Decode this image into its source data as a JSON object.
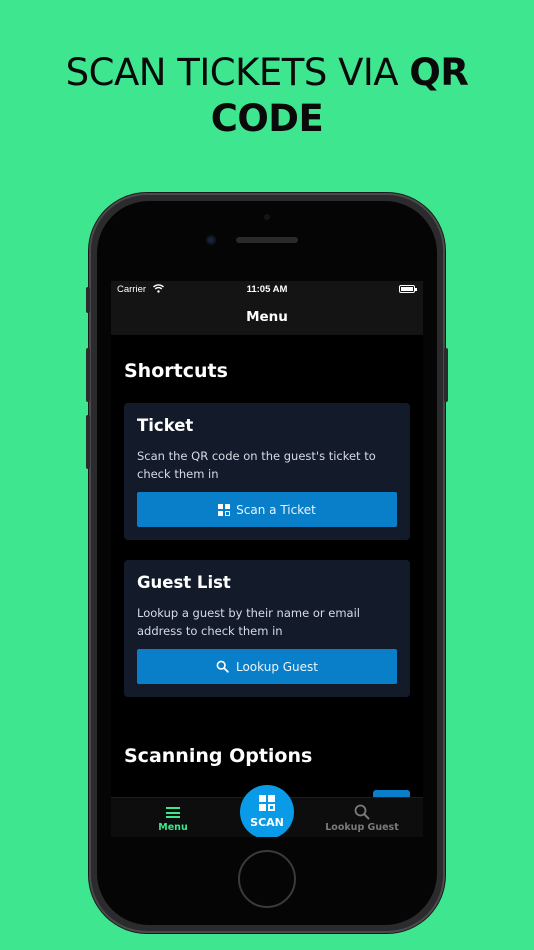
{
  "headline": {
    "light": "SCAN TICKETS VIA ",
    "bold_1": "QR",
    "bold_2": "CODE"
  },
  "status_bar": {
    "carrier": "Carrier",
    "time": "11:05 AM"
  },
  "nav": {
    "title": "Menu"
  },
  "shortcuts": {
    "title": "Shortcuts",
    "ticket_card": {
      "title": "Ticket",
      "description": "Scan the QR code on the guest's ticket to check them in",
      "button_label": "Scan a Ticket",
      "button_icon": "qr-code-icon"
    },
    "guest_card": {
      "title": "Guest List",
      "description": "Lookup a guest by their name or email address to check them in",
      "button_label": "Lookup Guest",
      "button_icon": "search-icon"
    }
  },
  "scanning_options": {
    "title": "Scanning Options"
  },
  "tab_bar": {
    "menu": {
      "label": "Menu",
      "icon": "hamburger-icon",
      "active": true
    },
    "scan": {
      "label": "SCAN",
      "icon": "qr-code-icon"
    },
    "lookup": {
      "label": "Lookup Guest",
      "icon": "search-icon"
    }
  },
  "colors": {
    "background": "#3ee68f",
    "card": "#131b2b",
    "button": "#0a7fc9",
    "fab": "#0a9be8",
    "accent": "#3ee68f"
  }
}
